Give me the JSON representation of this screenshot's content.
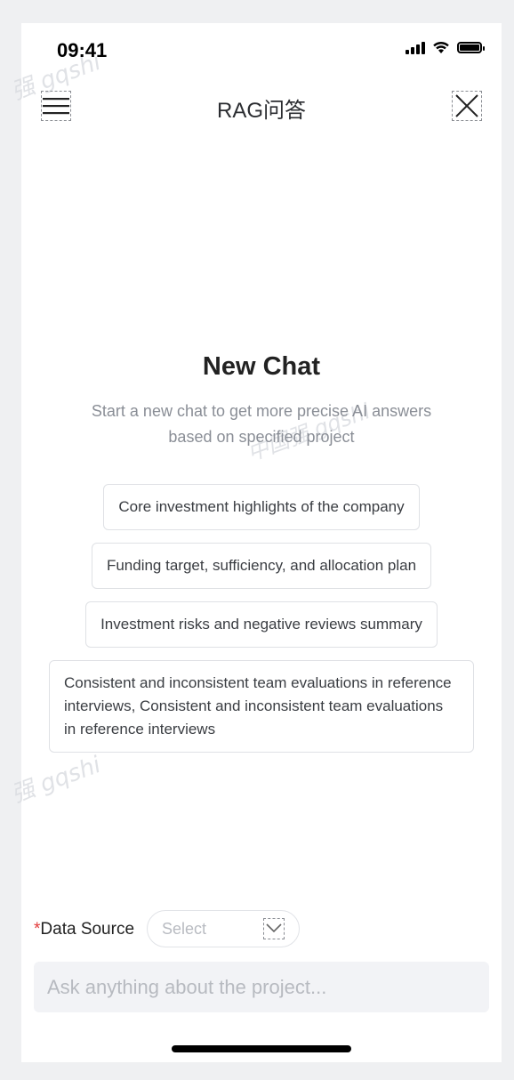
{
  "watermark": {
    "text_a": "强 gqshi",
    "text_b": "中国强 gqshi",
    "text_c": "强 gqshi"
  },
  "status_bar": {
    "time": "09:41",
    "icons": [
      "signal-icon",
      "wifi-icon",
      "battery-icon"
    ]
  },
  "nav": {
    "title": "RAG问答",
    "left_icon": "menu-icon",
    "right_icon": "close-icon"
  },
  "empty_state": {
    "title": "New Chat",
    "subtitle": "Start a new chat to get more precise AI answers based on specified project",
    "suggestions": [
      "Core investment highlights of the company",
      "Funding target, sufficiency, and allocation plan",
      "Investment risks and negative reviews summary",
      "Consistent and inconsistent team evaluations in reference interviews, Consistent and inconsistent team evaluations in reference interviews"
    ]
  },
  "data_source": {
    "required_mark": "*",
    "label": "Data Source",
    "placeholder": "Select",
    "icon": "dropdown-icon"
  },
  "composer": {
    "placeholder": "Ask anything about the project..."
  },
  "colors": {
    "background": "#eff0f2",
    "required": "#e23b3b",
    "text": "#222222"
  }
}
